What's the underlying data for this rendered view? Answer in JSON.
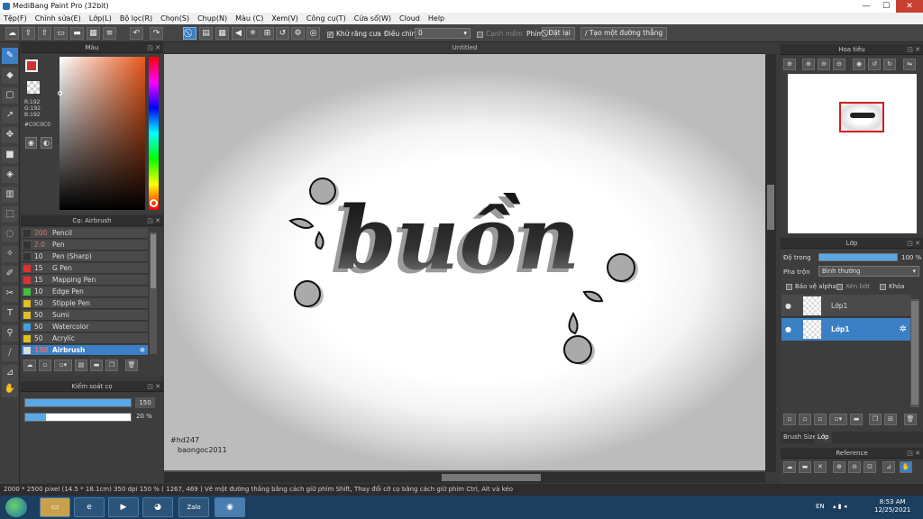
{
  "window": {
    "title": "MediBang Paint Pro (32bit)",
    "minimize": "—",
    "maximize": "☐",
    "close": "✕"
  },
  "menu": [
    "Tệp(F)",
    "Chỉnh sửa(E)",
    "Lớp(L)",
    "Bộ lọc(R)",
    "Chọn(S)",
    "Chụp(N)",
    "Màu (C)",
    "Xem(V)",
    "Công cụ(T)",
    "Cửa sổ(W)",
    "Cloud",
    "Help"
  ],
  "toolbar": {
    "antialias_label": "Khử răng cưa",
    "adjust_label": "Điều chỉnh",
    "adjust_value": "0",
    "edge_label": "Cạnh mềm",
    "key_label": "Phím",
    "reset_button": "Đặt lại",
    "straight_line_button": "Tạo một đường thẳng"
  },
  "color_panel": {
    "title": "Màu",
    "r": "R:192",
    "g": "G:192",
    "b": "B:192",
    "hex": "#C0C0C0",
    "primary_color": "#cc3333",
    "secondary_color": "#c0c0c0"
  },
  "brush_panel": {
    "title": "Cọ: Airbrush",
    "items": [
      {
        "size": "200",
        "name": "Pencil",
        "color": "#333333",
        "size_color": "#e07070"
      },
      {
        "size": "2.0",
        "name": "Pen",
        "color": "#333333",
        "size_color": "#e07070"
      },
      {
        "size": "10",
        "name": "Pen (Sharp)",
        "color": "#333333",
        "size_color": "#dddddd"
      },
      {
        "size": "15",
        "name": "G Pen",
        "color": "#e03030",
        "size_color": "#dddddd"
      },
      {
        "size": "15",
        "name": "Mapping Pen",
        "color": "#e03030",
        "size_color": "#dddddd"
      },
      {
        "size": "10",
        "name": "Edge Pen",
        "color": "#40c040",
        "size_color": "#dddddd"
      },
      {
        "size": "50",
        "name": "Stipple Pen",
        "color": "#e0c020",
        "size_color": "#dddddd"
      },
      {
        "size": "50",
        "name": "Sumi",
        "color": "#e0c020",
        "size_color": "#dddddd"
      },
      {
        "size": "50",
        "name": "Watercolor",
        "color": "#40a0e0",
        "size_color": "#dddddd"
      },
      {
        "size": "50",
        "name": "Acrylic",
        "color": "#e0c020",
        "size_color": "#dddddd"
      },
      {
        "size": "150",
        "name": "Airbrush",
        "color": "#dddddd",
        "size_color": "#e07070",
        "active": true
      }
    ]
  },
  "brush_control": {
    "title": "Kiểm soát cọ",
    "size_value": "150",
    "size_fill": 1.0,
    "opacity_value": "20 %",
    "opacity_fill": 0.2
  },
  "canvas": {
    "title": "Untitled",
    "artwork_text": "buồn",
    "signature_line1": "#hd247",
    "signature_line2": "baongoc2011"
  },
  "navigator": {
    "title": "Hoa tiêu"
  },
  "layer_panel": {
    "title": "Lớp",
    "opacity_label": "Độ trong",
    "opacity_value": "100 %",
    "blend_label": "Pha trộn",
    "blend_value": "Bình thường",
    "protect_alpha": "Bảo vệ alpha",
    "clipping": "Xén bớt",
    "lock": "Khóa",
    "layers": [
      {
        "name": "Lớp1",
        "active": false
      },
      {
        "name": "Lớp1",
        "active": true
      }
    ],
    "tab_brush_size": "Brush Size",
    "tab_layer": "Lớp"
  },
  "reference": {
    "title": "Reference"
  },
  "status": {
    "text": "2000 * 2500 pixel   (14.5 * 18.1cm)   350 dpi   150 %   ( 1267, 469 )   Vẽ một đường thẳng bằng cách giữ phím Shift, Thay đổi cỡ cọ bằng cách giữ phím Ctrl, Alt và kéo"
  },
  "taskbar": {
    "lang": "EN",
    "time": "8:53 AM",
    "date": "12/25/2021",
    "zalo": "Zalo"
  }
}
